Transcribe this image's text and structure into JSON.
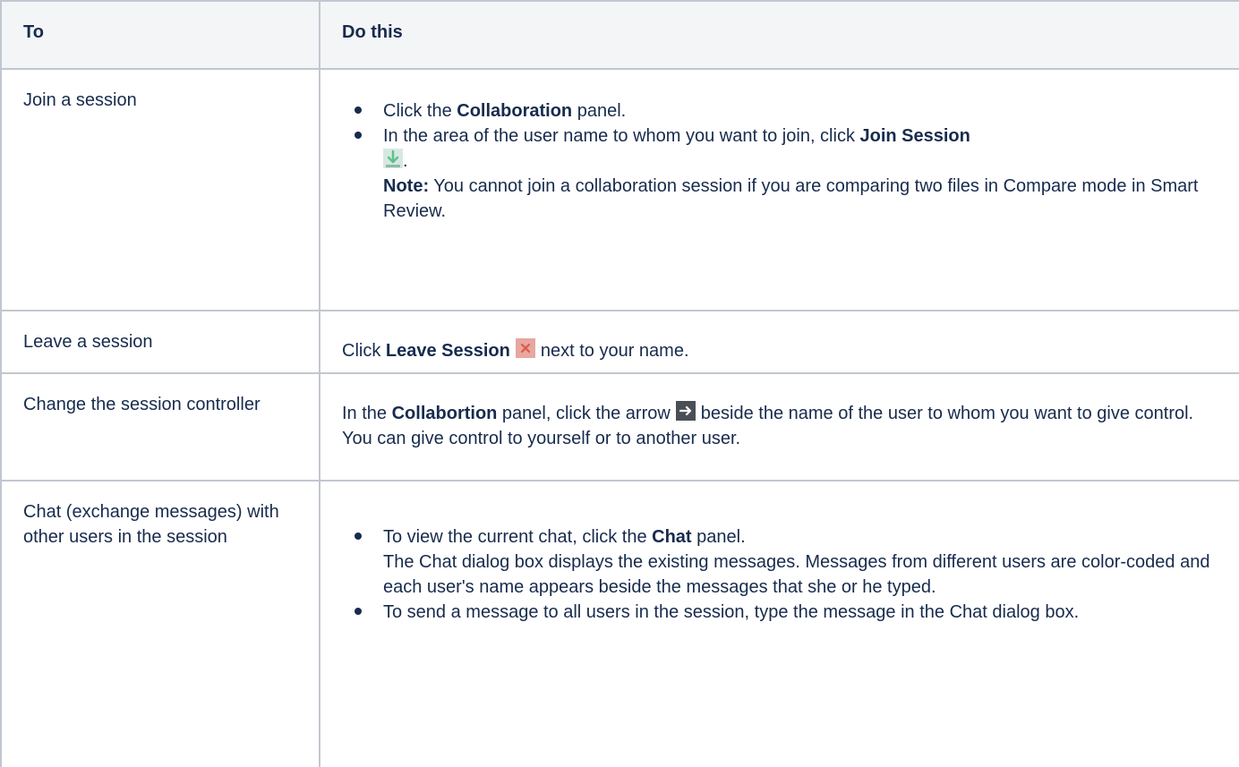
{
  "table": {
    "headers": {
      "to": "To",
      "do_this": "Do this"
    },
    "rows": [
      {
        "to": "Join a session",
        "steps": [
          {
            "pre": "Click the ",
            "bold": "Collaboration",
            "post": " panel."
          },
          {
            "pre": "In the area of the user name to whom you want to join, click ",
            "bold": "Join Session",
            "icon": "join-session-icon",
            "post": ".",
            "note_label": "Note:",
            "note_text": " You cannot join a collaboration session if you are comparing two files in Compare mode in Smart Review."
          }
        ]
      },
      {
        "to": "Leave a session",
        "pre": "Click ",
        "bold": "Leave Session",
        "icon": "leave-session-icon",
        "post": "next to your name."
      },
      {
        "to": "Change the session controller",
        "pre": "In the ",
        "bold": "Collabortion",
        "mid": " panel, click the arrow",
        "icon": "arrow-right-icon",
        "post": "beside the name of the user to whom you want to give control. You can give control to yourself or to another user."
      },
      {
        "to": "Chat (exchange messages) with other users in the session",
        "steps": [
          {
            "pre": "To view the current chat, click the ",
            "bold": "Chat",
            "post": " panel.",
            "detail": "The Chat dialog box displays the existing messages. Messages from different users are color-coded and each user's name appears beside the messages that she or he typed."
          },
          {
            "pre": "To send a message to all users in the session, type the message in the Chat dialog box."
          }
        ]
      }
    ]
  },
  "colors": {
    "border": "#c1c7d0",
    "header_bg": "#f4f5f7",
    "text": "#172b4d",
    "join_icon": "#5cc28a",
    "leave_icon": "#e0574b",
    "arrow_icon_bg": "#4a4f57"
  }
}
